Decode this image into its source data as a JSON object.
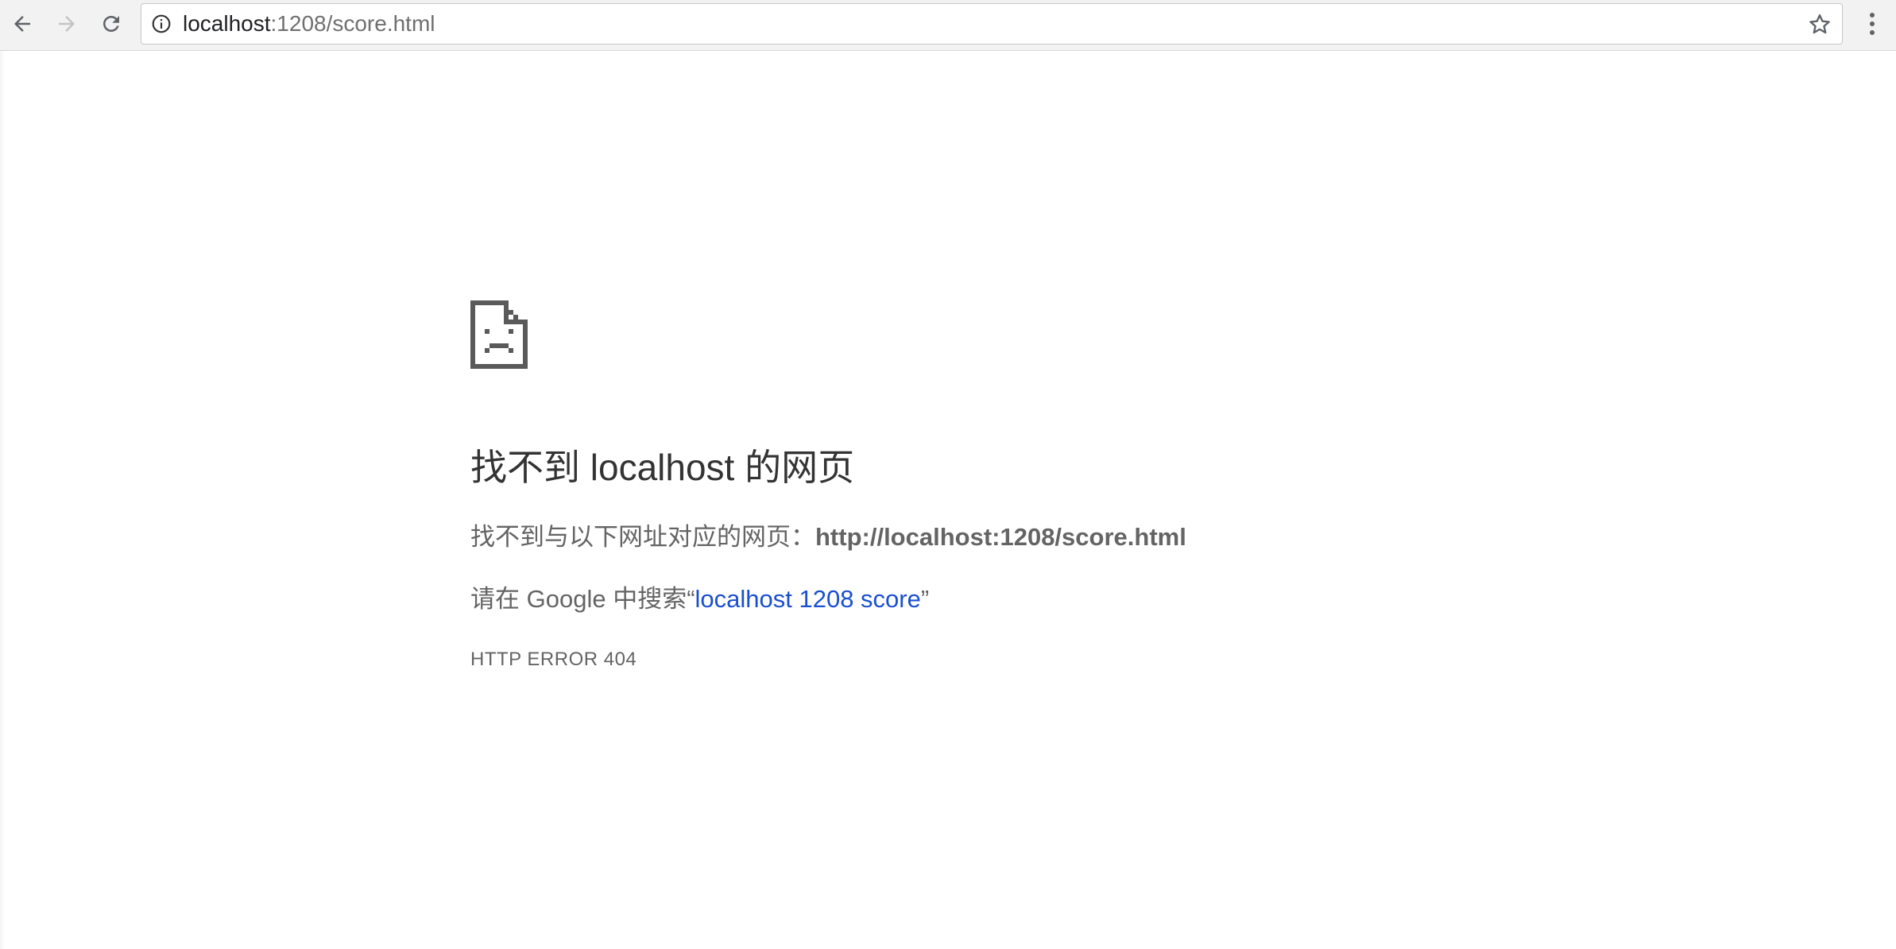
{
  "browser": {
    "url_host": "localhost",
    "url_rest": ":1208/score.html",
    "back_icon": "arrow-left-icon",
    "forward_icon": "arrow-right-icon",
    "reload_icon": "reload-icon",
    "info_icon": "info-icon",
    "bookmark_icon": "star-icon",
    "menu_icon": "vertical-dots-icon"
  },
  "error_page": {
    "icon": "sad-page-icon",
    "heading": "找不到 localhost 的网页",
    "subline_prefix": "找不到与以下网址对应的网页：",
    "subline_url": "http://localhost:1208/score.html",
    "search_prefix": "请在 Google 中搜索“",
    "search_link": "localhost 1208 score",
    "search_suffix": "”",
    "error_code": "HTTP ERROR 404"
  },
  "colors": {
    "link": "#1a4fd0",
    "text": "#646464",
    "heading": "#333333"
  }
}
